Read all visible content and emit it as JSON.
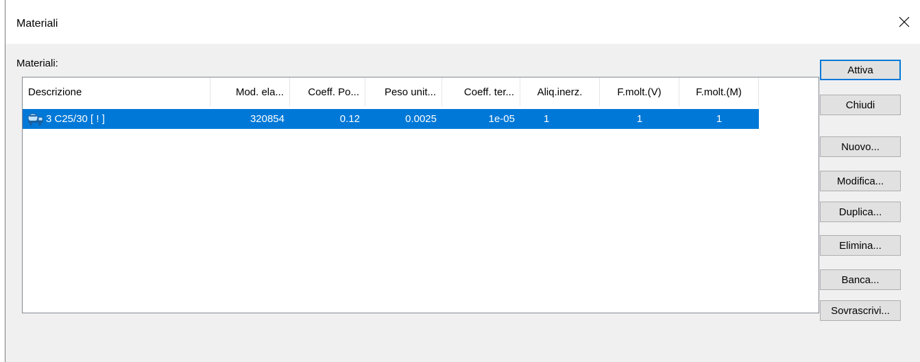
{
  "window": {
    "title": "Materiali",
    "close_icon": "close-icon"
  },
  "list": {
    "label": "Materiali:",
    "columns": [
      "Descrizione",
      "Mod. ela...",
      "Coeff. Po...",
      "Peso unit...",
      "Coeff. ter...",
      "Aliq.inerz.",
      "F.molt.(V)",
      "F.molt.(M)"
    ],
    "rows": [
      {
        "icon": "concrete-mixer-icon",
        "selected": true,
        "cells": [
          "3 C25/30 [ ! ]",
          "320854",
          "0.12",
          "0.0025",
          "1e-05",
          "1",
          "1",
          "1"
        ]
      }
    ],
    "selection_color": "#0078d7"
  },
  "buttons": {
    "attiva": "Attiva",
    "chiudi": "Chiudi",
    "nuovo": "Nuovo...",
    "modifica": "Modifica...",
    "duplica": "Duplica...",
    "elimina": "Elimina...",
    "banca": "Banca...",
    "sovrascrivi": "Sovrascrivi..."
  }
}
